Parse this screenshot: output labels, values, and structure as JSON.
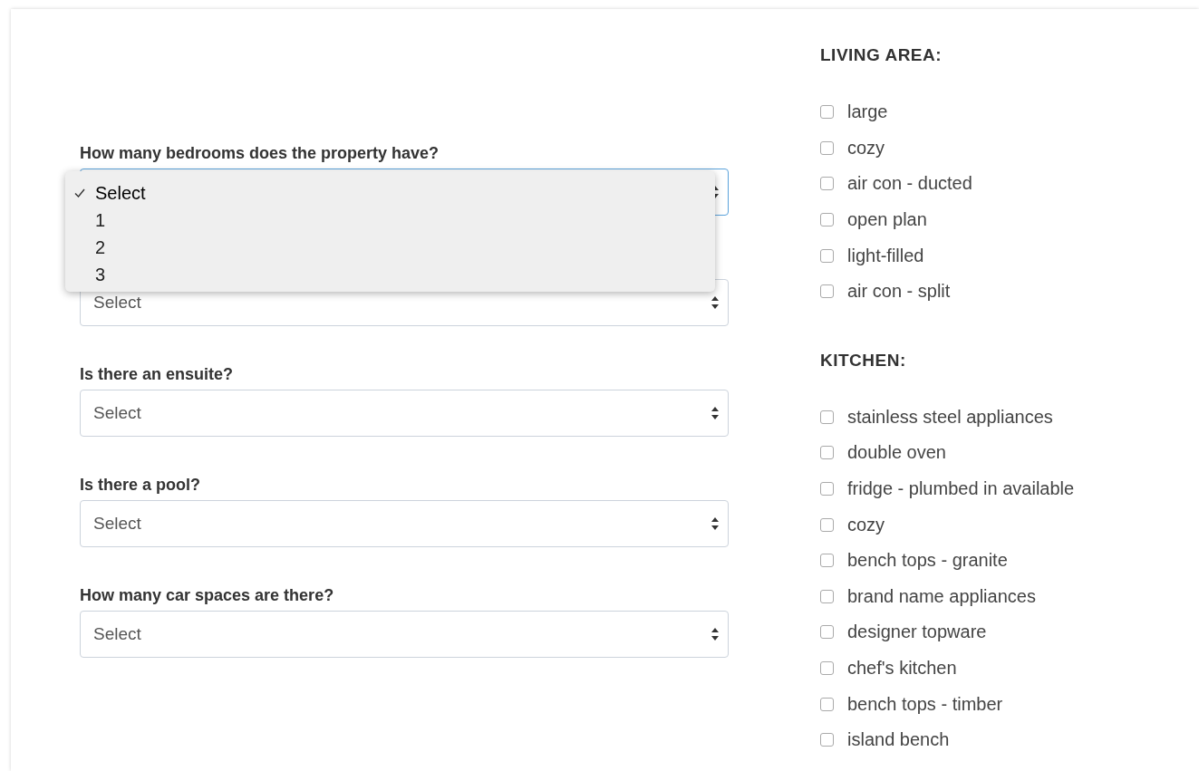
{
  "questions": [
    {
      "label": "How many bedrooms does the property have?",
      "focused": true,
      "options": [
        {
          "label": "Select",
          "selected": true
        },
        {
          "label": "1",
          "selected": false
        },
        {
          "label": "2",
          "selected": false
        },
        {
          "label": "3",
          "selected": false
        }
      ]
    },
    {
      "value": "Select",
      "focused": false
    },
    {
      "label": "Is there an ensuite?",
      "value": "Select",
      "focused": false
    },
    {
      "label": "Is there a pool?",
      "value": "Select",
      "focused": false
    },
    {
      "label": "How many car spaces are there?",
      "value": "Select",
      "focused": false
    }
  ],
  "groups": [
    {
      "title": "LIVING AREA:",
      "items": [
        {
          "label": "large",
          "checked": false
        },
        {
          "label": "cozy",
          "checked": false
        },
        {
          "label": "air con - ducted",
          "checked": false
        },
        {
          "label": "open plan",
          "checked": false
        },
        {
          "label": "light-filled",
          "checked": false
        },
        {
          "label": "air con - split",
          "checked": false
        }
      ]
    },
    {
      "title": "KITCHEN:",
      "items": [
        {
          "label": "stainless steel appliances",
          "checked": false
        },
        {
          "label": "double oven",
          "checked": false
        },
        {
          "label": "fridge - plumbed in available",
          "checked": false
        },
        {
          "label": "cozy",
          "checked": false
        },
        {
          "label": "bench tops - granite",
          "checked": false
        },
        {
          "label": "brand name appliances",
          "checked": false
        },
        {
          "label": "designer topware",
          "checked": false
        },
        {
          "label": "chef's kitchen",
          "checked": false
        },
        {
          "label": "bench tops - timber",
          "checked": false
        },
        {
          "label": "island bench",
          "checked": false
        }
      ]
    }
  ]
}
